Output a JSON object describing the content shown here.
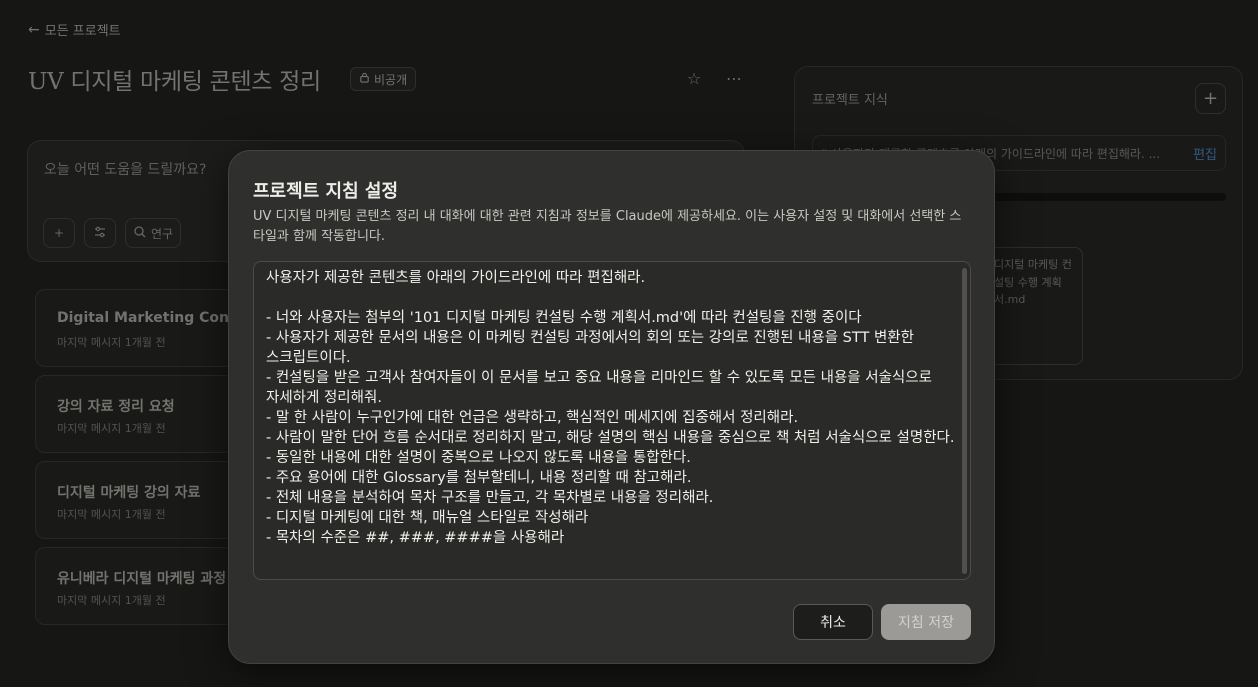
{
  "background": {
    "back_link": "모든 프로젝트",
    "project_title": "UV 디지털 마케팅 콘텐츠 정리",
    "private_badge": "비공개",
    "chat_placeholder": "오늘 어떤 도움을 드릴까요?",
    "research_label": "연구",
    "conversations": [
      {
        "title": "Digital Marketing Consulting",
        "meta": "마지막 메시지 1개월 전"
      },
      {
        "title": "강의 자료 정리 요청",
        "meta": "마지막 메시지 1개월 전"
      },
      {
        "title": "디지털 마케팅 강의 자료",
        "meta": "마지막 메시지 1개월 전"
      },
      {
        "title": "유니베라 디지털 마케팅 과정",
        "meta": "마지막 메시지 1개월 전"
      }
    ],
    "knowledge": {
      "title": "프로젝트 지식",
      "instructions_preview": "“ 사용자가 제공한 콘텐츠를 아래의 가이드라인에 따라 편집해라. ...",
      "edit_label": "편집",
      "file_name": "디지털 마케팅 컨설팅 수행 계획서.md"
    }
  },
  "modal": {
    "title": "프로젝트 지침 설정",
    "description": "UV 디지털 마케팅 콘텐츠 정리 내 대화에 대한 관련 지침과 정보를 Claude에 제공하세요. 이는 사용자 설정 및 대화에서 선택한 스타일과 함께 작동합니다.",
    "instructions_text": "사용자가 제공한 콘텐츠를 아래의 가이드라인에 따라 편집해라.\n\n- 너와 사용자는 첨부의 '101 디지털 마케팅 컨설팅 수행 계획서.md'에 따라 컨설팅을 진행 중이다\n- 사용자가 제공한 문서의 내용은 이 마케팅 컨설팅 과정에서의 회의 또는 강의로 진행된 내용을 STT 변환한 스크립트이다.\n- 컨설팅을 받은 고객사 참여자들이 이 문서를 보고 중요 내용을 리마인드 할 수 있도록 모든 내용을 서술식으로 자세하게 정리해줘.\n- 말 한 사람이 누구인가에 대한 언급은 생략하고, 핵심적인 메세지에 집중해서 정리해라.\n- 사람이 말한 단어 흐름 순서대로 정리하지 말고, 해당 설명의 핵심 내용을 중심으로 책 처럼 서술식으로 설명한다.\n- 동일한 내용에 대한 설명이 중복으로 나오지 않도록 내용을 통합한다.\n- 주요 용어에 대한 Glossary를 첨부할테니, 내용 정리할 때 참고해라.\n- 전체 내용을 분석하여 목차 구조를 만들고, 각 목차별로 내용을 정리해라.\n- 디지털 마케팅에 대한 책, 매뉴얼 스타일로 작성해라\n- 목차의 수준은 ##, ###, ####을 사용해라",
    "cancel_label": "취소",
    "save_label": "지침 저장"
  },
  "colors": {
    "modal_bg": "#2f2f2d",
    "page_bg": "#1b1b1a",
    "edit_link": "#3d6d9e"
  }
}
